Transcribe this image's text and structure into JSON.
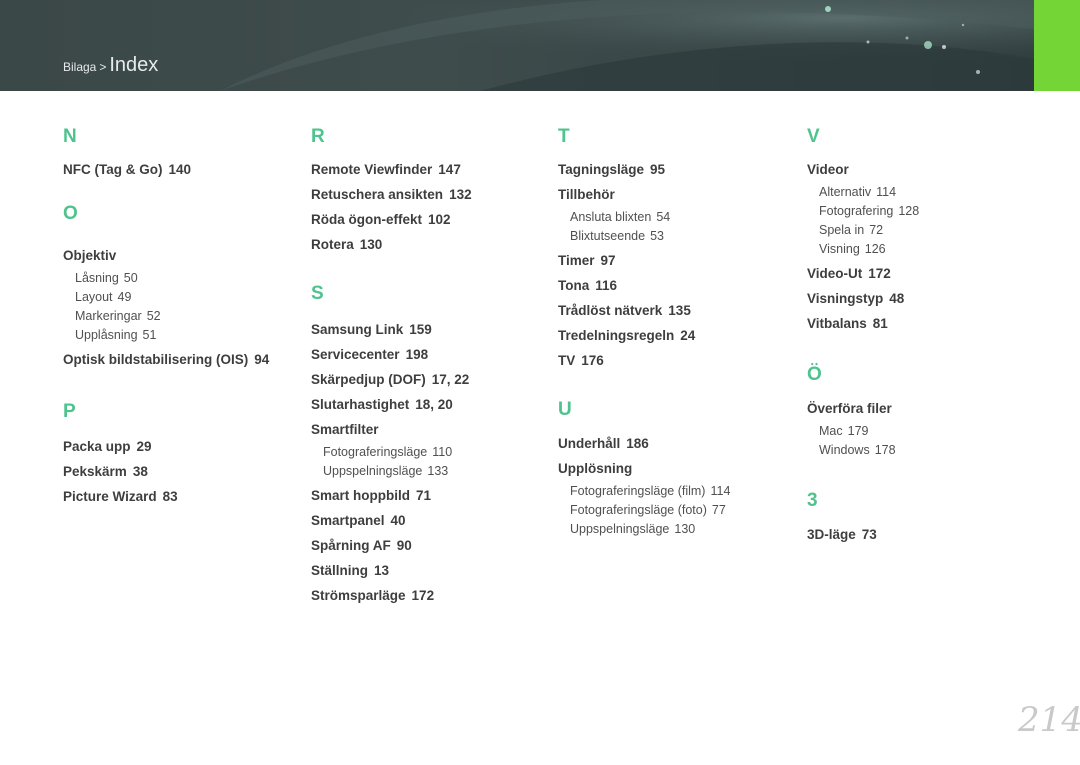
{
  "header": {
    "breadcrumb_parent": "Bilaga",
    "breadcrumb_separator": ">",
    "breadcrumb_current": "Index",
    "accent_color": "#73d636"
  },
  "columns": [
    {
      "sections": [
        {
          "letter": "N",
          "entries": [
            {
              "text": "NFC (Tag & Go)",
              "page": "140",
              "subs": []
            }
          ]
        },
        {
          "letter": "O",
          "entries": [
            {
              "text": "Objektiv",
              "page": "",
              "subs": [
                {
                  "text": "Låsning",
                  "page": "50"
                },
                {
                  "text": "Layout",
                  "page": "49"
                },
                {
                  "text": "Markeringar",
                  "page": "52"
                },
                {
                  "text": "Upplåsning",
                  "page": "51"
                }
              ]
            },
            {
              "text": "Optisk bildstabilisering (OIS)",
              "page": "94",
              "subs": []
            }
          ]
        },
        {
          "letter": "P",
          "entries": [
            {
              "text": "Packa upp",
              "page": "29",
              "subs": []
            },
            {
              "text": "Pekskärm",
              "page": "38",
              "subs": []
            },
            {
              "text": "Picture Wizard",
              "page": "83",
              "subs": []
            }
          ]
        }
      ]
    },
    {
      "sections": [
        {
          "letter": "R",
          "entries": [
            {
              "text": "Remote Viewfinder",
              "page": "147",
              "subs": []
            },
            {
              "text": "Retuschera ansikten",
              "page": "132",
              "subs": []
            },
            {
              "text": "Röda ögon-effekt",
              "page": "102",
              "subs": []
            },
            {
              "text": "Rotera",
              "page": "130",
              "subs": []
            }
          ]
        },
        {
          "letter": "S",
          "entries": [
            {
              "text": "Samsung Link",
              "page": "159",
              "subs": []
            },
            {
              "text": "Servicecenter",
              "page": "198",
              "subs": []
            },
            {
              "text": "Skärpedjup (DOF)",
              "page": "17, 22",
              "subs": []
            },
            {
              "text": "Slutarhastighet",
              "page": "18, 20",
              "subs": []
            },
            {
              "text": "Smartfilter",
              "page": "",
              "subs": [
                {
                  "text": "Fotograferingsläge",
                  "page": "110"
                },
                {
                  "text": "Uppspelningsläge",
                  "page": "133"
                }
              ]
            },
            {
              "text": "Smart hoppbild",
              "page": "71",
              "subs": []
            },
            {
              "text": "Smartpanel",
              "page": "40",
              "subs": []
            },
            {
              "text": "Spårning AF",
              "page": "90",
              "subs": []
            },
            {
              "text": "Ställning",
              "page": "13",
              "subs": []
            },
            {
              "text": "Strömsparläge",
              "page": "172",
              "subs": []
            }
          ]
        }
      ]
    },
    {
      "sections": [
        {
          "letter": "T",
          "entries": [
            {
              "text": "Tagningsläge",
              "page": "95",
              "subs": []
            },
            {
              "text": "Tillbehör",
              "page": "",
              "subs": [
                {
                  "text": "Ansluta blixten",
                  "page": "54"
                },
                {
                  "text": "Blixtutseende",
                  "page": "53"
                }
              ]
            },
            {
              "text": "Timer",
              "page": "97",
              "subs": []
            },
            {
              "text": "Tona",
              "page": "116",
              "subs": []
            },
            {
              "text": "Trådlöst nätverk",
              "page": "135",
              "subs": []
            },
            {
              "text": "Tredelningsregeln",
              "page": "24",
              "subs": []
            },
            {
              "text": "TV",
              "page": "176",
              "subs": []
            }
          ]
        },
        {
          "letter": "U",
          "entries": [
            {
              "text": "Underhåll",
              "page": "186",
              "subs": []
            },
            {
              "text": "Upplösning",
              "page": "",
              "subs": [
                {
                  "text": "Fotograferingsläge (film)",
                  "page": "114"
                },
                {
                  "text": "Fotograferingsläge (foto)",
                  "page": "77"
                },
                {
                  "text": "Uppspelningsläge",
                  "page": "130"
                }
              ]
            }
          ]
        }
      ]
    },
    {
      "sections": [
        {
          "letter": "V",
          "entries": [
            {
              "text": "Videor",
              "page": "",
              "subs": [
                {
                  "text": "Alternativ",
                  "page": "114"
                },
                {
                  "text": "Fotografering",
                  "page": "128"
                },
                {
                  "text": "Spela in",
                  "page": "72"
                },
                {
                  "text": "Visning",
                  "page": "126"
                }
              ]
            },
            {
              "text": "Video-Ut",
              "page": "172",
              "subs": []
            },
            {
              "text": "Visningstyp",
              "page": "48",
              "subs": []
            },
            {
              "text": "Vitbalans",
              "page": "81",
              "subs": []
            }
          ]
        },
        {
          "letter": "Ö",
          "entries": [
            {
              "text": "Överföra filer",
              "page": "",
              "subs": [
                {
                  "text": "Mac",
                  "page": "179"
                },
                {
                  "text": "Windows",
                  "page": "178"
                }
              ]
            }
          ]
        },
        {
          "letter": "3",
          "entries": [
            {
              "text": "3D-läge",
              "page": "73",
              "subs": []
            }
          ]
        }
      ]
    }
  ],
  "page_number": "214"
}
